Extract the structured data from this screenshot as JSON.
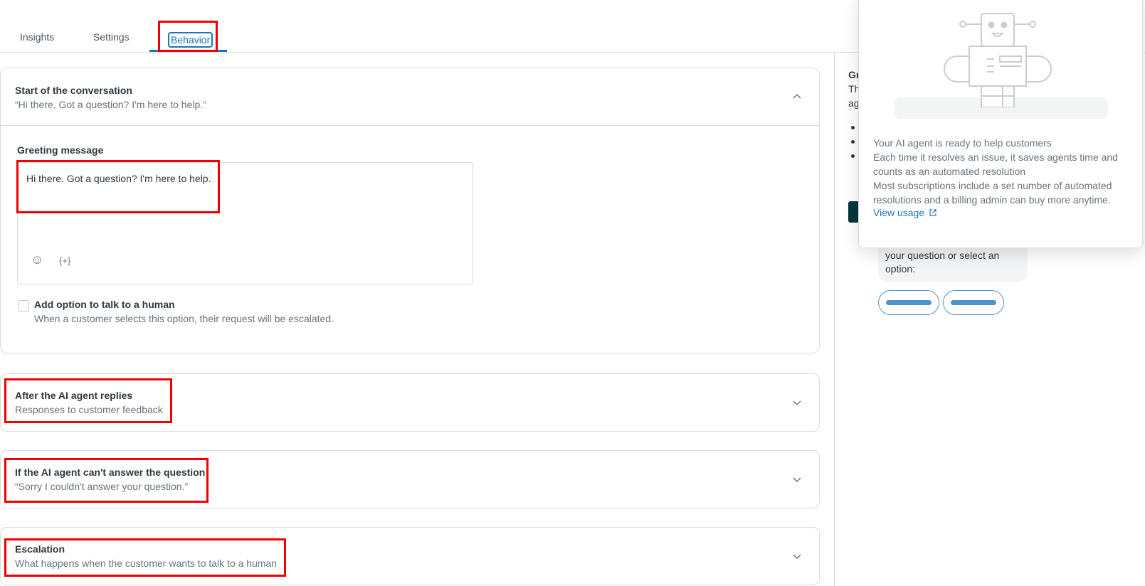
{
  "tabs": {
    "insights": "Insights",
    "settings": "Settings",
    "behavior": "Behavior"
  },
  "start_section": {
    "title": "Start of the conversation",
    "subtitle": "“Hi there. Got a question? I'm here to help.”",
    "greeting_label": "Greeting message",
    "greeting_value": "Hi there. Got a question? I'm here to help.",
    "emoji_icon": "☺",
    "variable_icon": "{+}",
    "checkbox_label": "Add option to talk to a human",
    "checkbox_hint": "When a customer selects this option, their request will be escalated."
  },
  "after_section": {
    "title": "After the AI agent replies",
    "subtitle": "Responses to customer feedback"
  },
  "cant_answer_section": {
    "title": "If the AI agent can't answer the question",
    "subtitle": "“Sorry I couldn't answer your question.”"
  },
  "escalation_section": {
    "title": "Escalation",
    "subtitle": "What happens when the customer wants to talk to a human"
  },
  "preview": {
    "frag1": "Gr",
    "frag2": "Th",
    "frag3": "ag",
    "bubble_text": "your question or select an option:"
  },
  "popover": {
    "line1": "Your AI agent is ready to help customers",
    "line2": "Each time it resolves an issue, it saves agents time and counts as an automated resolution",
    "line3": "Most subscriptions include a set number of automated resolutions and a billing admin can buy more anytime.",
    "link": "View usage"
  },
  "colors": {
    "accent": "#1f73b7",
    "highlight": "#ee0000"
  }
}
